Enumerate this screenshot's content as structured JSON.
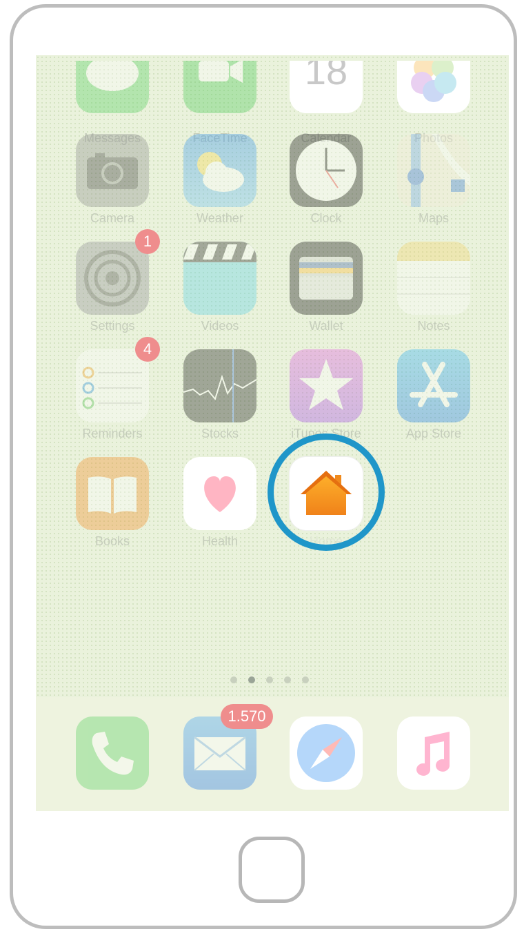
{
  "apps": {
    "messages": "Messages",
    "facetime": "FaceTime",
    "calendar": "Calendar",
    "calendar_day": "18",
    "photos": "Photos",
    "camera": "Camera",
    "weather": "Weather",
    "clock": "Clock",
    "maps": "Maps",
    "settings": "Settings",
    "settings_badge": "1",
    "videos": "Videos",
    "wallet": "Wallet",
    "notes": "Notes",
    "reminders": "Reminders",
    "reminders_badge": "4",
    "stocks": "Stocks",
    "itunes": "iTunes Store",
    "appstore": "App Store",
    "books": "Books",
    "health": "Health",
    "home": "Home"
  },
  "dock": {
    "phone": "phone-icon",
    "mail": "mail-icon",
    "mail_badge": "1.570",
    "safari": "safari-icon",
    "music": "music-icon"
  },
  "page_indicator": {
    "pages": 5,
    "current": 2
  },
  "colors": {
    "highlight_ring": "#1f96c9",
    "home_icon": "#f39a1c",
    "badge": "#ef8d8d",
    "wallpaper": "#eaf2dc"
  }
}
